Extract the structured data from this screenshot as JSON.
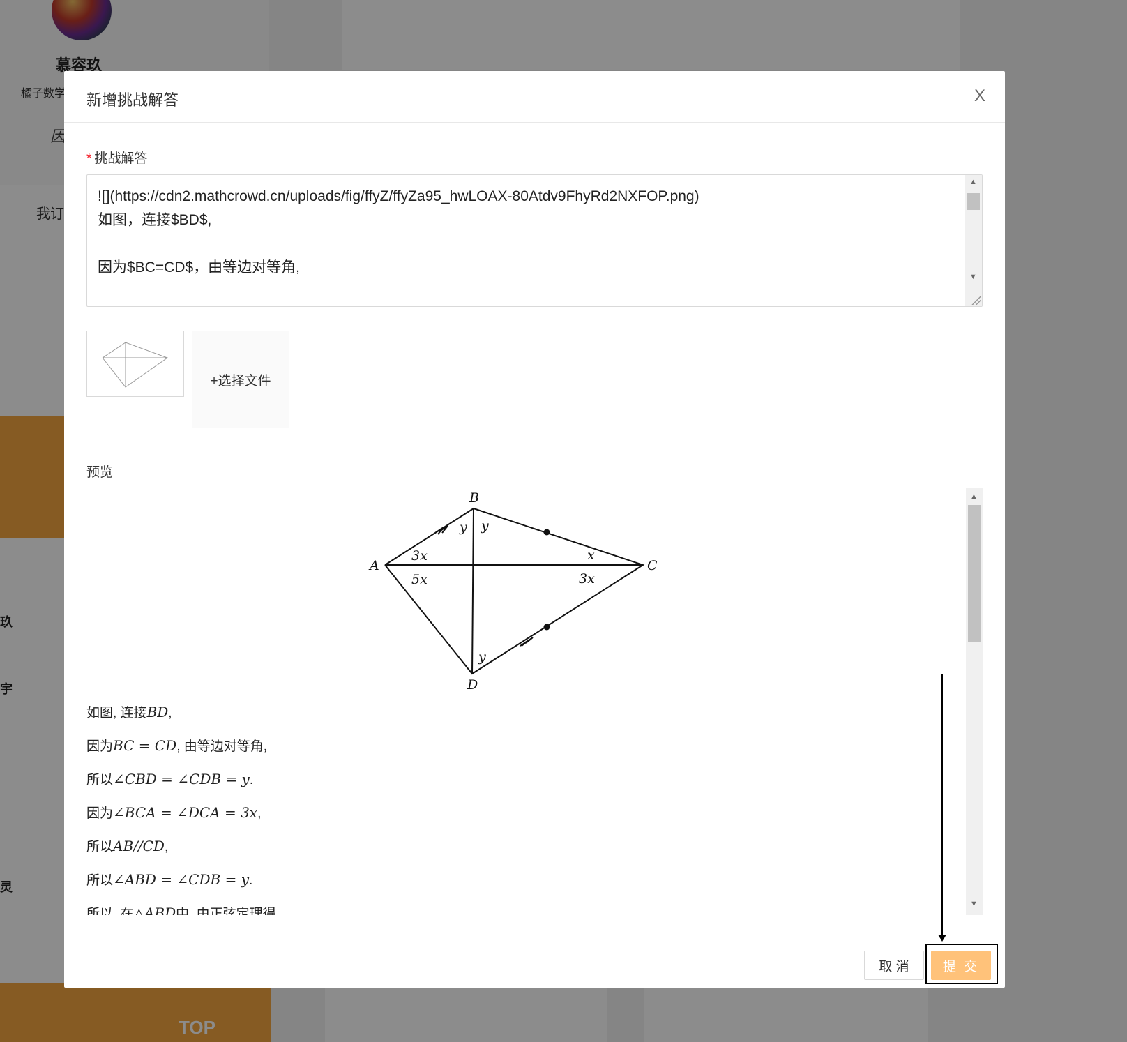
{
  "background": {
    "username": "慕容玖",
    "school": "橘子数学",
    "italic_char": "因",
    "subscribe": "我订",
    "side_chars": [
      "玖",
      "宇",
      "灵"
    ],
    "top_label": "TOP"
  },
  "modal": {
    "title": "新增挑战解答",
    "close_label": "X",
    "field_label": "挑战解答",
    "required_mark": "*",
    "textarea_lines": [
      "![](https://cdn2.mathcrowd.cn/uploads/fig/ffyZ/ffyZa95_hwLOAX-80Atdv9FhyRd2NXFOP.png)",
      "如图，连接$BD$,",
      "",
      "因为$BC=CD$，由等边对等角,"
    ],
    "upload_label": "+选择文件",
    "preview_label": "预览",
    "figure": {
      "vertices": [
        "A",
        "B",
        "C",
        "D"
      ],
      "angle_labels": [
        "y",
        "y",
        "x",
        "3x",
        "5x",
        "3x",
        "y"
      ]
    },
    "solution": [
      {
        "prefix": "如图, 连接",
        "math": "BD",
        "suffix": ","
      },
      {
        "prefix": "因为",
        "math": "BC = CD",
        "suffix": ", 由等边对等角,"
      },
      {
        "prefix": "所以",
        "math": "∠CBD = ∠CDB = y",
        "suffix": "."
      },
      {
        "prefix": "因为",
        "math": "∠BCA = ∠DCA = 3x",
        "suffix": ","
      },
      {
        "prefix": "所以",
        "math": "AB//CD",
        "suffix": ","
      },
      {
        "prefix": "所以",
        "math": "∠ABD = ∠CDB = y",
        "suffix": "."
      },
      {
        "prefix": "所以, 在",
        "math": "△ABD",
        "suffix": "中, 由正弦定理得"
      }
    ],
    "cancel_label": "取 消",
    "submit_label": "提 交"
  },
  "colors": {
    "accent": "#ffc27a",
    "required": "#f5222d"
  }
}
